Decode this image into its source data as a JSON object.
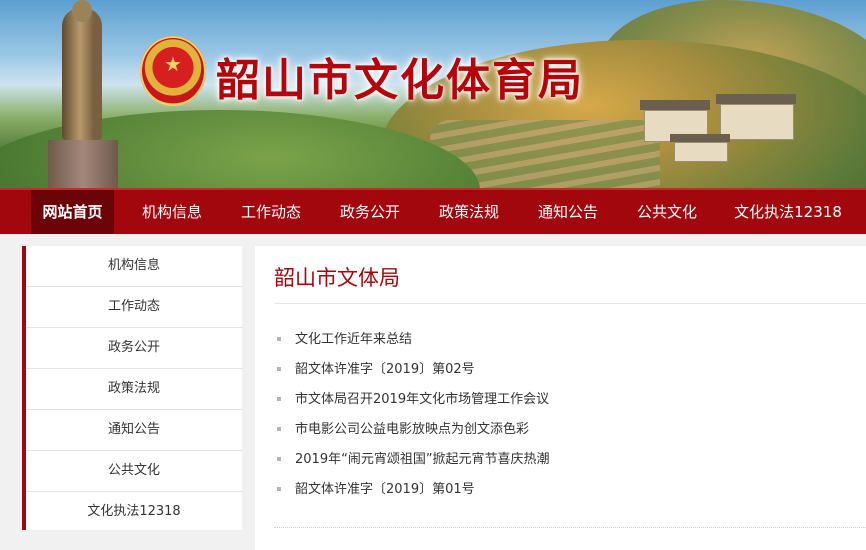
{
  "header": {
    "site_title": "韶山市文化体育局"
  },
  "nav": {
    "items": [
      {
        "label": "网站首页",
        "active": true
      },
      {
        "label": "机构信息",
        "active": false
      },
      {
        "label": "工作动态",
        "active": false
      },
      {
        "label": "政务公开",
        "active": false
      },
      {
        "label": "政策法规",
        "active": false
      },
      {
        "label": "通知公告",
        "active": false
      },
      {
        "label": "公共文化",
        "active": false
      },
      {
        "label": "文化执法12318",
        "active": false
      }
    ]
  },
  "sidebar": {
    "items": [
      {
        "label": "机构信息"
      },
      {
        "label": "工作动态"
      },
      {
        "label": "政务公开"
      },
      {
        "label": "政策法规"
      },
      {
        "label": "通知公告"
      },
      {
        "label": "公共文化"
      },
      {
        "label": "文化执法12318"
      }
    ]
  },
  "main": {
    "title": "韶山市文体局",
    "news": [
      {
        "title": "文化工作近年来总结"
      },
      {
        "title": "韶文体许准字〔2019〕第02号"
      },
      {
        "title": "市文体局召开2019年文化市场管理工作会议"
      },
      {
        "title": "市电影公司公益电影放映点为创文添色彩"
      },
      {
        "title": "2019年“闹元宵颂祖国”掀起元宵节喜庆热潮"
      },
      {
        "title": "韶文体许准字〔2019〕第01号"
      }
    ]
  },
  "colors": {
    "brand_red": "#a3070e",
    "nav_active": "#6c0308"
  }
}
